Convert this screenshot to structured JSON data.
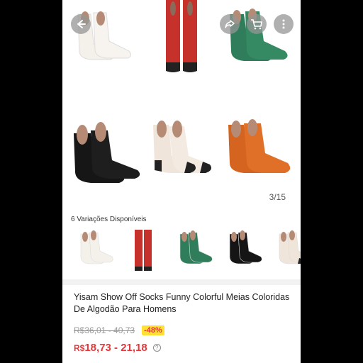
{
  "gallery": {
    "pager_text": "3/15",
    "colors": [
      "#f4f0ea",
      "#c7312b",
      "#2f7d5a",
      "#151515",
      "#efe5da",
      "#d4641f"
    ]
  },
  "header": {
    "icons": [
      "back-arrow-icon",
      "share-icon",
      "cart-icon",
      "more-icon"
    ]
  },
  "variations": {
    "title": "6 Variações Disponíveis",
    "items": [
      {
        "color": "#f4f0ea",
        "trim": "#f4f0ea"
      },
      {
        "color": "#c7312b",
        "trim": "#222222"
      },
      {
        "color": "#2f7d5a",
        "trim": "#2f7d5a"
      },
      {
        "color": "#151515",
        "trim": "#151515"
      },
      {
        "color": "#efe5da",
        "trim": "#222222"
      }
    ]
  },
  "product": {
    "title": "Yisam Show Off Socks Funny Colorful Meias Coloridas De Algodão Para Homens",
    "old_price": "R$36,01 - 40,73",
    "discount": "-48%",
    "currency": "R$",
    "price": "18,73 - 21,18"
  }
}
